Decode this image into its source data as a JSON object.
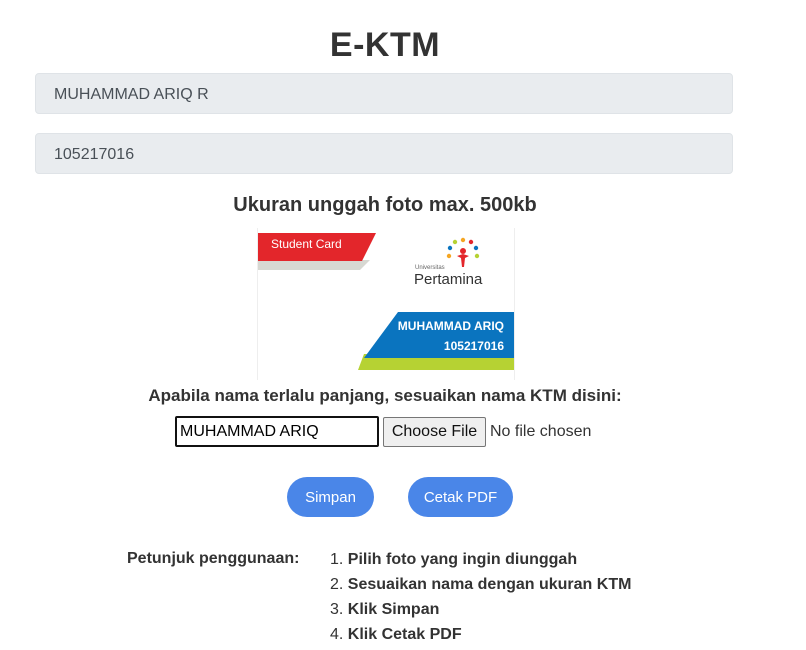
{
  "page": {
    "title": "E-KTM"
  },
  "profile": {
    "name": "MUHAMMAD ARIQ R",
    "nim": "105217016"
  },
  "upload": {
    "note": "Ukuran unggah foto max. 500kb"
  },
  "card": {
    "label": "Student Card",
    "brand_small": "Universitas",
    "brand": "Pertamina",
    "name": "MUHAMMAD ARIQ",
    "nim": "105217016",
    "colors": {
      "red": "#e3262b",
      "blue": "#0a74bf",
      "green": "#b6d233",
      "gray": "#d7d8d2"
    }
  },
  "adjust": {
    "note": "Apabila nama terlalu panjang, sesuaikan nama KTM disini:",
    "name_value": "MUHAMMAD ARIQ",
    "file_button": "Choose File",
    "file_status": "No file chosen"
  },
  "actions": {
    "save": "Simpan",
    "pdf": "Cetak PDF"
  },
  "instructions": {
    "label": "Petunjuk penggunaan:",
    "steps": [
      {
        "num": "1.",
        "text": "Pilih foto yang ingin diunggah"
      },
      {
        "num": "2.",
        "text": "Sesuaikan nama dengan ukuran KTM"
      },
      {
        "num": "3.",
        "text": "Klik Simpan"
      },
      {
        "num": "4.",
        "text": "Klik Cetak PDF"
      }
    ]
  },
  "theme": {
    "primary": "#4a86e8",
    "field_bg": "#e9ecef"
  }
}
